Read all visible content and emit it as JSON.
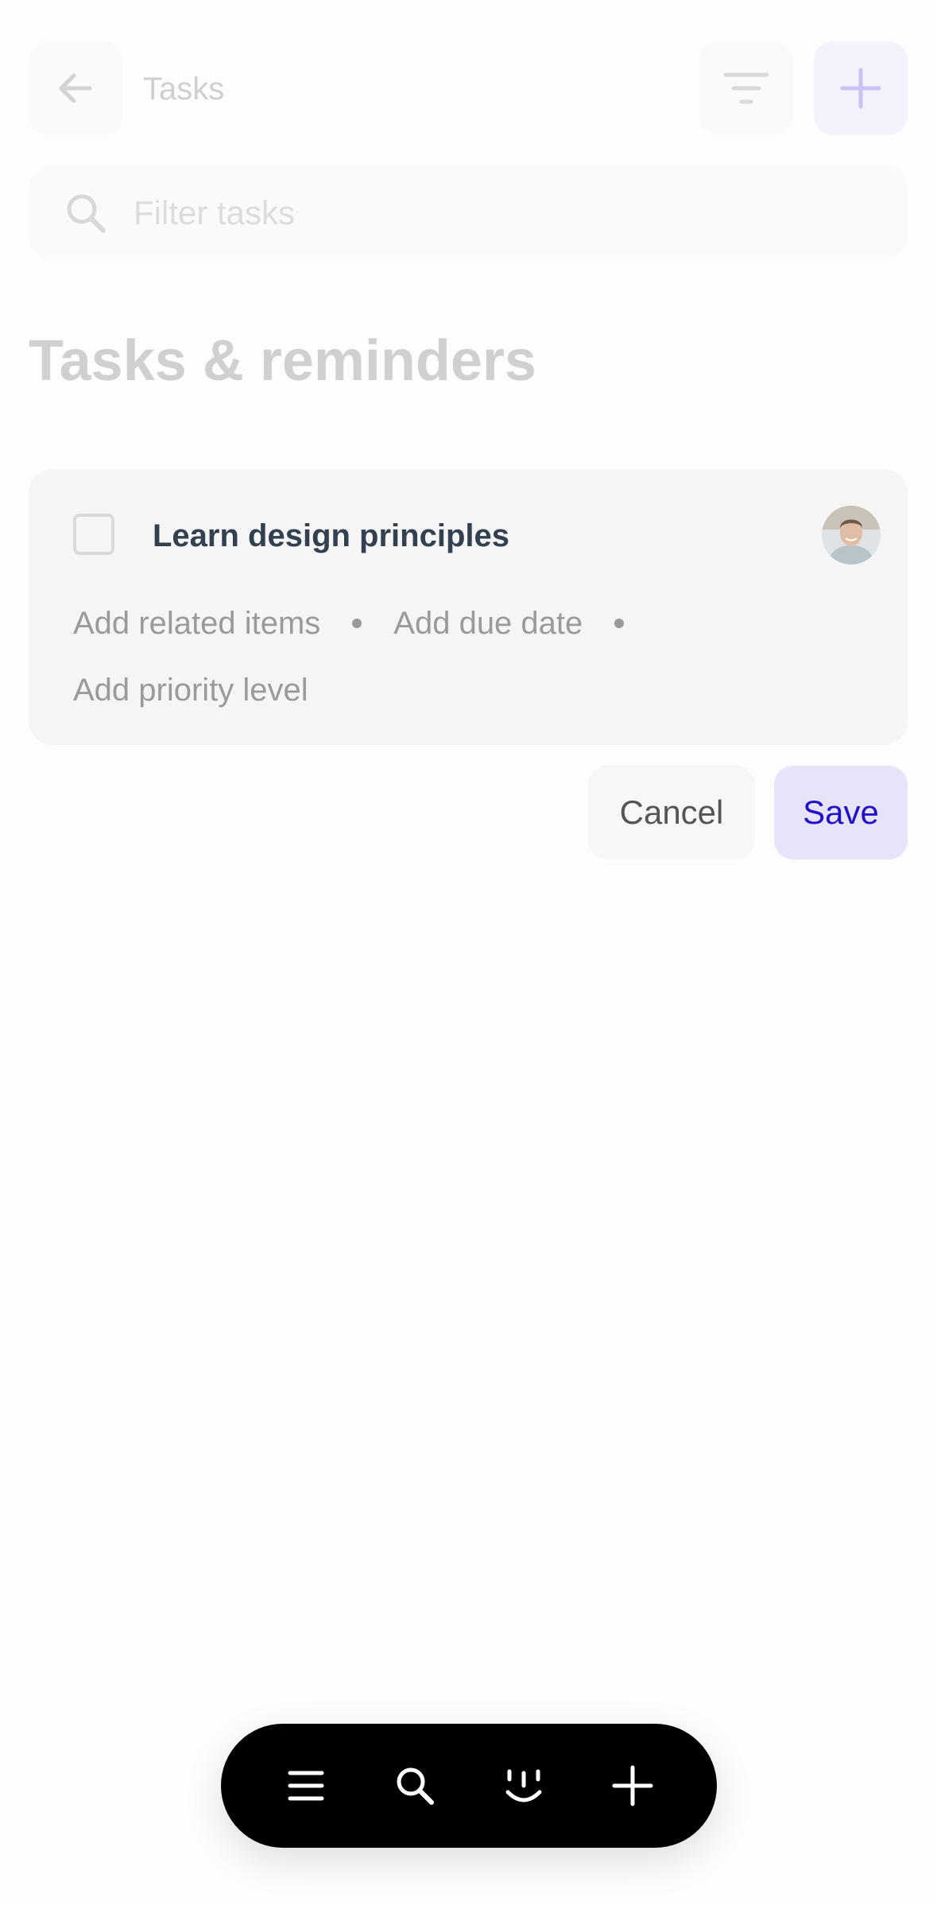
{
  "header": {
    "title": "Tasks",
    "back_icon": "arrow-left-icon",
    "filter_icon": "filter-icon",
    "add_icon": "plus-icon"
  },
  "search": {
    "placeholder": "Filter tasks",
    "value": ""
  },
  "section": {
    "heading": "Tasks & reminders"
  },
  "task": {
    "title": "Learn design principles",
    "checked": false,
    "meta": {
      "related": "Add related items",
      "due_date": "Add due date",
      "priority": "Add priority level"
    }
  },
  "actions": {
    "cancel_label": "Cancel",
    "save_label": "Save"
  },
  "dock": {
    "items": [
      "menu-icon",
      "search-icon",
      "assistant-face-icon",
      "plus-icon"
    ]
  },
  "colors": {
    "accent": "#1f12c8",
    "accent_bg": "#e6e3fb",
    "dock_bg": "#000000"
  }
}
